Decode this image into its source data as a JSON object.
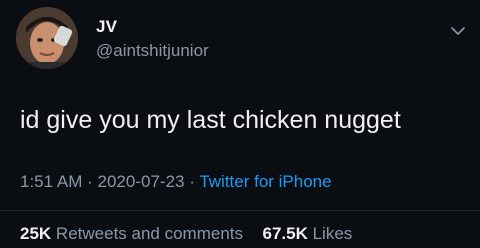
{
  "user": {
    "display_name": "JV",
    "handle": "@aintshitjunior"
  },
  "tweet": {
    "text": "id give you my last chicken nugget",
    "time": "1:51 AM",
    "separator": "·",
    "date": "2020-07-23",
    "source": "Twitter for iPhone"
  },
  "stats": {
    "retweets_count": "25K",
    "retweets_label": "Retweets and comments",
    "likes_count": "67.5K",
    "likes_label": "Likes"
  },
  "icons": {
    "menu": "chevron-down-icon"
  }
}
